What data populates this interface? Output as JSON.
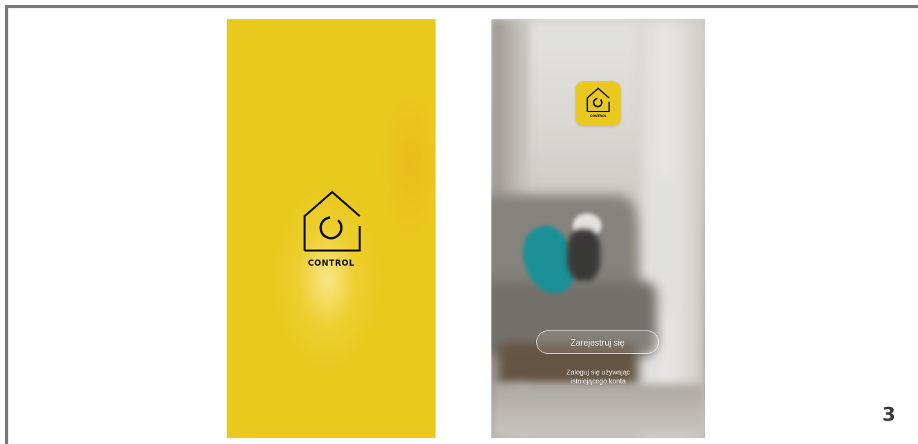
{
  "splash": {
    "brand": "CONTROL",
    "background_color": "#eac91f"
  },
  "welcome": {
    "app_icon": {
      "name": "house-icon",
      "label": "CONTROL",
      "color": "#eac91f"
    },
    "register_button": "Zarejestruj się",
    "login_link_line1": "Zaloguj się używając",
    "login_link_line2": "istniejącego konta"
  },
  "page_number": "3"
}
